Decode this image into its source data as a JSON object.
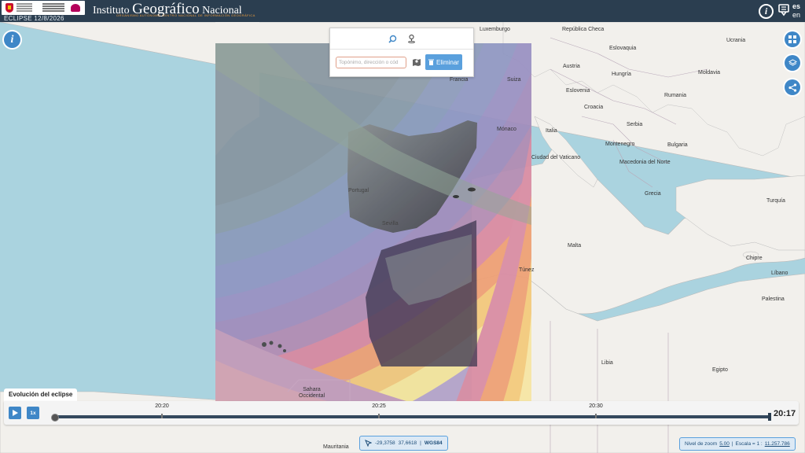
{
  "header": {
    "eclipse_label": "ECLIPSE 12/8/2026",
    "brand_part1": "Instituto ",
    "brand_part2": "Geográfico",
    "brand_part3": " Nacional",
    "brand_sub": "ORGANISMO AUTÓNOMO  CENTRO NACIONAL DE INFORMACIÓN GEOGRÁFICA",
    "lang_current": "es",
    "lang_other": "en"
  },
  "search": {
    "placeholder": "Topónimo, dirección o cód",
    "clear_label": "Eliminar"
  },
  "map_labels": {
    "luxemburgo": "Luxemburgo",
    "republica_checa": "República Checa",
    "eslovaquia": "Eslovaquia",
    "ucrania": "Ucrania",
    "austria": "Austria",
    "hungria": "Hungría",
    "moldavia": "Moldavia",
    "suiza": "Suiza",
    "francia": "Francia",
    "eslovenia": "Eslovenia",
    "croacia": "Croacia",
    "rumania": "Rumania",
    "monaco": "Mónaco",
    "italia": "Italia",
    "serbia": "Serbia",
    "montenegro": "Montenegro",
    "bulgaria": "Bulgaria",
    "ciudad_vaticano": "Ciudad del Vaticano",
    "macedonia": "Macedonia del Norte",
    "portugal": "Portugal",
    "grecia": "Grecia",
    "turquia": "Turquía",
    "sevilla": "Sevilla",
    "malta": "Malta",
    "chipre": "Chipre",
    "tunez": "Túnez",
    "libano": "Líbano",
    "palestina": "Palestina",
    "libia": "Libia",
    "egipto": "Egipto",
    "sahara": "Sahara\nOccidental",
    "mauritania": "Mauritania"
  },
  "timeline": {
    "title": "Evolución del eclipse",
    "speed_label": "1x",
    "ticks": [
      "20:20",
      "20:25",
      "20:30"
    ],
    "current_time": "20:17",
    "progress": 0.0
  },
  "coords": {
    "lon": "-29,3758",
    "lat": "37,6618",
    "crs": "WGS84"
  },
  "scale": {
    "zoom_label": "Nivel de zoom",
    "zoom_value": "5.00",
    "scale_label": "Escala = 1 :",
    "scale_value": "11.257.786"
  },
  "colors": {
    "header_bg": "#2b3e50",
    "accent": "#3f87c7",
    "sea": "#aad3df",
    "land": "#f2f0ec"
  }
}
